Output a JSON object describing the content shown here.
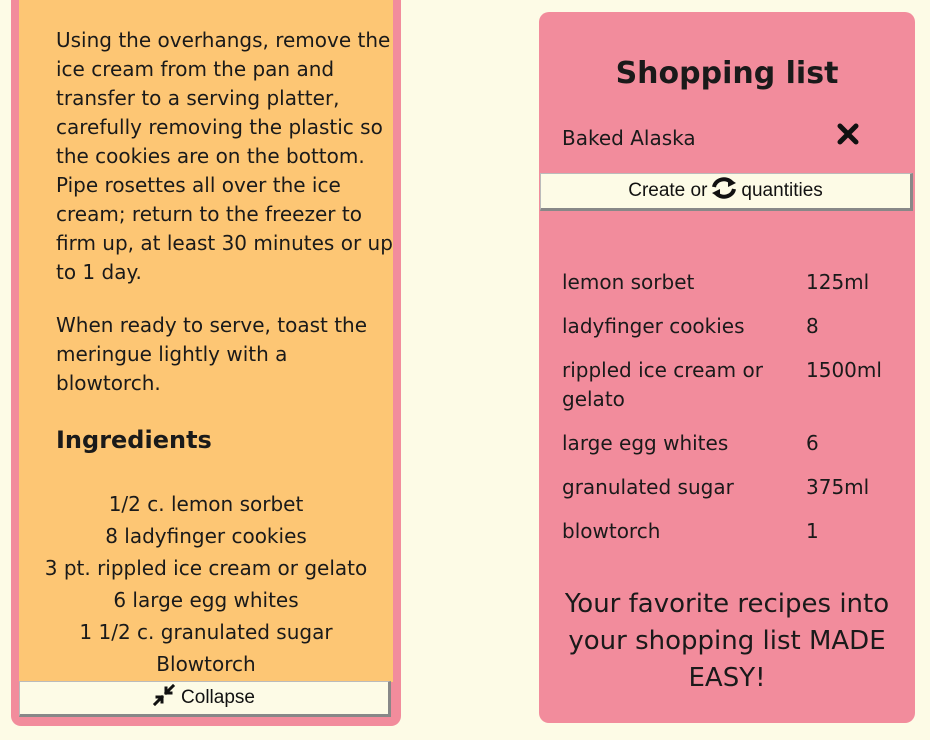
{
  "recipe": {
    "instructions": [
      "Using the overhangs, remove the ice cream from the pan and transfer to a serving platter, carefully removing the plastic so the cookies are on the bottom. Pipe rosettes all over the ice cream; return to the freezer to firm up, at least 30 minutes or up to 1 day.",
      "When ready to serve, toast the meringue lightly with a blowtorch."
    ],
    "ingredients_title": "Ingredients",
    "ingredients": [
      "1/2 c. lemon sorbet",
      "8 ladyfinger cookies",
      "3 pt. rippled ice cream or gelato",
      "6 large egg whites",
      "1 1/2 c. granulated sugar",
      "Blowtorch"
    ],
    "collapse_label": "Collapse",
    "collapse_icon": "collapse-arrows-icon"
  },
  "shopping_list": {
    "title": "Shopping list",
    "recipes": [
      {
        "name": "Baked Alaska",
        "remove_icon": "close-icon"
      }
    ],
    "create_button": {
      "before": "Create or",
      "icon": "refresh-icon",
      "after": "quantities"
    },
    "items": [
      {
        "name": "lemon sorbet",
        "qty": "125ml"
      },
      {
        "name": "ladyfinger cookies",
        "qty": "8"
      },
      {
        "name": "rippled ice cream or gelato",
        "qty": "1500ml"
      },
      {
        "name": "large egg whites",
        "qty": "6"
      },
      {
        "name": "granulated sugar",
        "qty": "375ml"
      },
      {
        "name": "blowtorch",
        "qty": "1"
      }
    ],
    "tagline": "Your favorite recipes into your shopping list MADE EASY!"
  },
  "colors": {
    "background": "#fdfbe6",
    "card_pink": "#f28c9c",
    "card_orange": "#fdc674"
  }
}
